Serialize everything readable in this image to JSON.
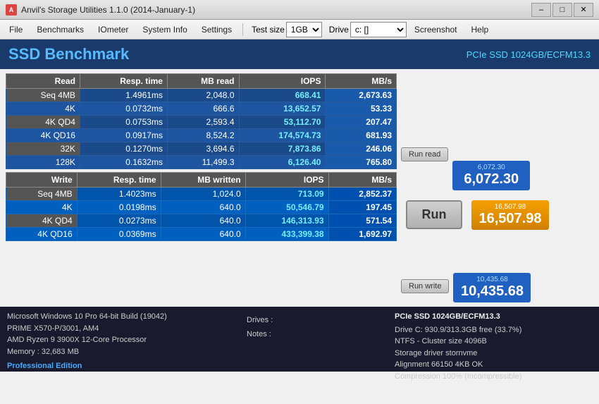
{
  "titleBar": {
    "title": "Anvil's Storage Utilities 1.1.0 (2014-January-1)",
    "icon": "A",
    "minBtn": "–",
    "maxBtn": "□",
    "closeBtn": "✕"
  },
  "menuBar": {
    "file": "File",
    "benchmarks": "Benchmarks",
    "iometer": "IOmeter",
    "systemInfo": "System Info",
    "settings": "Settings",
    "testSizeLabel": "Test size",
    "testSizeValue": "1GB",
    "driveLabel": "Drive",
    "driveValue": "c: []",
    "screenshot": "Screenshot",
    "help": "Help"
  },
  "header": {
    "title": "SSD Benchmark",
    "subtitle": "PCIe SSD 1024GB/ECFM13.3"
  },
  "readTable": {
    "headers": [
      "Read",
      "Resp. time",
      "MB read",
      "IOPS",
      "MB/s"
    ],
    "rows": [
      [
        "Seq 4MB",
        "1.4961ms",
        "2,048.0",
        "668.41",
        "2,673.63"
      ],
      [
        "4K",
        "0.0732ms",
        "666.6",
        "13,652.57",
        "53.33"
      ],
      [
        "4K QD4",
        "0.0753ms",
        "2,593.4",
        "53,112.70",
        "207.47"
      ],
      [
        "4K QD16",
        "0.0917ms",
        "8,524.2",
        "174,574.73",
        "681.93"
      ],
      [
        "32K",
        "0.1270ms",
        "3,694.6",
        "7,873.86",
        "246.06"
      ],
      [
        "128K",
        "0.1632ms",
        "11,499.3",
        "6,126.40",
        "765.80"
      ]
    ]
  },
  "writeTable": {
    "headers": [
      "Write",
      "Resp. time",
      "MB written",
      "IOPS",
      "MB/s"
    ],
    "rows": [
      [
        "Seq 4MB",
        "1.4023ms",
        "1,024.0",
        "713.09",
        "2,852.37"
      ],
      [
        "4K",
        "0.0198ms",
        "640.0",
        "50,546.79",
        "197.45"
      ],
      [
        "4K QD4",
        "0.0273ms",
        "640.0",
        "146,313.93",
        "571.54"
      ],
      [
        "4K QD16",
        "0.0369ms",
        "640.0",
        "433,399.38",
        "1,692.97"
      ]
    ]
  },
  "scores": {
    "readLabel": "6,072.30",
    "readValue": "6,072.30",
    "totalLabel": "16,507.98",
    "totalValue": "16,507.98",
    "writeLabel": "10,435.68",
    "writeValue": "10,435.68",
    "runBtn": "Run",
    "runReadBtn": "Run read",
    "runWriteBtn": "Run write"
  },
  "footer": {
    "os": "Microsoft Windows 10 Pro 64-bit Build (19042)",
    "motherboard": "PRIME X570-P/3001, AM4",
    "cpu": "AMD Ryzen 9 3900X 12-Core Processor",
    "memory": "Memory : 32,683 MB",
    "proEdition": "Professional Edition",
    "drivesLabel": "Drives :",
    "notesLabel": "Notes :",
    "driveInfo": "PCIe SSD 1024GB/ECFM13.3",
    "driveC": "Drive C: 930.9/313.3GB free (33.7%)",
    "ntfs": "NTFS - Cluster size 4096B",
    "storageDriver": "Storage driver  stornvme",
    "alignment": "Alignment 66150 4KB OK",
    "compression": "Compression 100% (Incompressible)"
  }
}
